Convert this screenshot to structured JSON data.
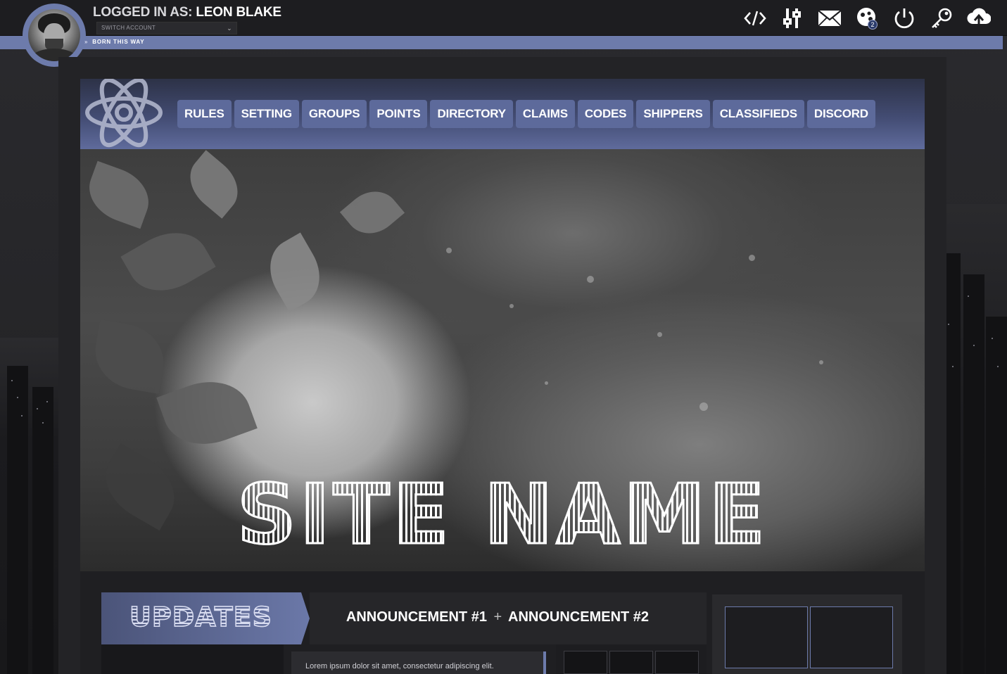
{
  "user": {
    "logged_in_prefix": "LOGGED IN AS:",
    "name": "LEON BLAKE",
    "switch_account": "SWITCH ACCOUNT",
    "motto": "BORN THIS WAY"
  },
  "toolbar": {
    "icons": [
      "code-icon",
      "controls-icon",
      "mail-icon",
      "alerts-icon",
      "power-icon",
      "key-icon",
      "upload-icon"
    ],
    "alerts_count": "2"
  },
  "nav": {
    "items": [
      "RULES",
      "SETTING",
      "GROUPS",
      "POINTS",
      "DIRECTORY",
      "CLAIMS",
      "CODES",
      "SHIPPERS",
      "CLASSIFIEDS",
      "DISCORD"
    ]
  },
  "hero": {
    "site_name": "SITE NAME"
  },
  "updates": {
    "title": "UPDATES",
    "announcement_1": "ANNOUNCEMENT #1",
    "plus": "+",
    "announcement_2": "ANNOUNCEMENT #2",
    "body": "Lorem ipsum dolor sit amet, consectetur adipiscing elit."
  },
  "colors": {
    "accent": "#6d7bab",
    "topbar": "#1d1d20",
    "background": "#232326"
  }
}
